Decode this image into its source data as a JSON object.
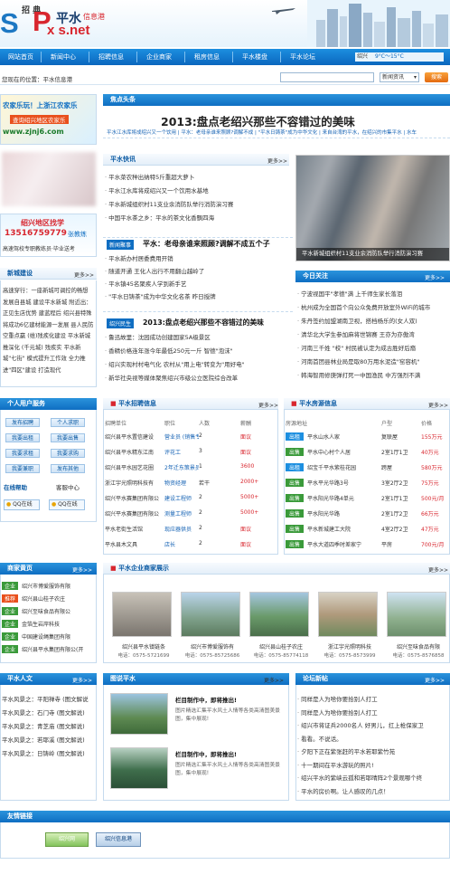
{
  "header": {
    "logo_left": "S",
    "logo_mid": "P",
    "logo_net": "x  s.net",
    "logo_top": "招 典",
    "logo_cn": "平水",
    "logo_tag": "信息港"
  },
  "nav": {
    "items": [
      "网站首页",
      "新闻中心",
      "招聘信息",
      "企业商家",
      "租房信息",
      "平水楼盘",
      "平水论坛"
    ],
    "weather_city": "绍兴",
    "weather_temp": "9°C～15°C"
  },
  "locbar": {
    "location": "您现在的位置：平水信息港",
    "search_placeholder": "",
    "select_value": "新闻资讯",
    "search_button": "搜索"
  },
  "left_ad1": {
    "line1": "农家乐玩！上浙江农家乐",
    "line2": "查询绍兴地区农家乐",
    "url": "www.zjnj6.com"
  },
  "left_ad2": {
    "title": "绍兴地区找学",
    "phone": "13516759779",
    "contact": "张教练",
    "slogan": "高速驾校专职教练员·毕业送考"
  },
  "headline": {
    "section": "焦点头条",
    "title": "2013:盘点老绍兴那些不容错过的美味",
    "subs": [
      "平水江水库将成绍兴又一个饮用",
      "平水：老母亲谁来照顾?调解不成",
      "\"平水日铸茶\"成为中华文化",
      "来自台湾的平水，在绍兴的市集平水",
      "水车"
    ]
  },
  "flash": {
    "section": "平水快讯",
    "more": "更多>>",
    "items": [
      "平水菜农种出纳特5斤重超大萝卜",
      "平水江水库将成绍兴又一个饮用水基地",
      "平水新城组织村11支业余消防队举行消防演习赛",
      "中国平水茶之乡：平水的茶文化香飘四海"
    ]
  },
  "photo_caption": "平水新城组织村11支业余消防队举行消防演习赛",
  "newsmass": {
    "tag": "新闻聚事",
    "title": "平水：老母亲谁来照顾?调解不成五个子",
    "items": [
      "平水新办村居委费用开销",
      "随道开通 王化人出行不用翻山越岭了",
      "平水镇45名聚疾人学到新手艺",
      "\"平水日铸茶\"成为中华文化名茶 昨日授牌"
    ]
  },
  "folk": {
    "tag": "绍兴民生",
    "title": "2013:盘点老绍兴那些不容错过的美味",
    "items": [
      "鲁迅故里：沈园成功创建国家5A级景区",
      "香精价格连年涨今年最低250元一斤 智德\"泡沫\"",
      "绍兴实现村村电气化 农村从\"用上电\"转变为\"用好电\"",
      "新华社央视等媒体聚焦绍兴市级公立医院综合改革"
    ]
  },
  "newcity": {
    "section": "新城建设",
    "more": "更多>>",
    "text": "高速穿行：一座新城可调控的畅想  发展自县城 建设平水新城  附近出：正见生店优势 建蓝程后  绍兴县特殊将成功6亿建材能源一发展  县人民防空重点赢 (维)残疾化建设  平水新城推深化 (千元城) 残疾实  平水新城\"七街\" 模式提升工作效  全力推进\"四区\"建设 打造现代"
  },
  "today": {
    "section": "今日关注",
    "more": "更多>>",
    "items": [
      "宁波视国平\"孝德\"满 上千师生家长落泪",
      "杭州成为全国首个向公众免费开放室外WiFi的城市",
      "朱丹签约加盟湖南卫视，搭档杨乐的(女人双)",
      "清华北大学生参加麻将世锦赛 王亦为亦傲湾",
      "河南三千姓 \"校\" 村民被认定为成古胜好后裔",
      "河南首团县林业局是取80万用水泥造\"窑容机\"",
      "韩海智用修庚弹打死一中国渔民 中方强烈不满"
    ]
  },
  "personal": {
    "section": "个人用户服务",
    "buttons": [
      "发布招聘",
      "个人求职",
      "我要出租",
      "我要出售",
      "我要求租",
      "我要求购",
      "我要兼职",
      "发布其他"
    ],
    "online_label": "在线帮助",
    "qq_label": "客服中心",
    "qq_btn": "QQ在线"
  },
  "jobs": {
    "section": "平水招聘信息",
    "more": "更多>>",
    "headers": [
      "招聘单位",
      "职位",
      "人数",
      "薪酬"
    ],
    "rows": [
      [
        "绍兴县平水置信建设",
        "营业员 (销售专",
        "2",
        "面议"
      ],
      [
        "绍兴县平水精东江南",
        "评花工",
        "3",
        "面议"
      ],
      [
        "绍兴县平水园艺花圈",
        "2年迁东策景员",
        "1",
        "3600"
      ],
      [
        "浙江宇光照明科技有",
        "物资经理",
        "若干",
        "2000+"
      ],
      [
        "绍兴平水赛集团有限公",
        "建设工程师",
        "2",
        "5000+"
      ],
      [
        "绍兴平水赛集团有限公",
        "测量工程师",
        "2",
        "5000+"
      ],
      [
        "平水老街生活馆",
        "现应器供员",
        "2",
        "面议"
      ],
      [
        "平水县木文具",
        "店长",
        "2",
        "面议"
      ]
    ]
  },
  "rent": {
    "section": "平水房源信息",
    "more": "更多>>",
    "headers": [
      "房源地址",
      "户型",
      "价格"
    ],
    "rows": [
      [
        "出租",
        "平水山水人家",
        "复联屋",
        "155万元"
      ],
      [
        "出售",
        "平水中心村个人居",
        "2室1厅1卫",
        "40万元"
      ],
      [
        "出租",
        "绍宝千平水紫桂花园",
        "跨屋",
        "580万元"
      ],
      [
        "出售",
        "平水平光华路3号",
        "3室2厅2卫",
        "75万元"
      ],
      [
        "出售",
        "平水阳光华路4单元",
        "2室1厅1卫",
        "500元/月"
      ],
      [
        "出售",
        "平水阳光华路",
        "2室1厅2卫",
        "66万元"
      ],
      [
        "出售",
        "平水新城建工大院",
        "4室2厅2卫",
        "47万元"
      ],
      [
        "出售",
        "平水大道四季时差家宁",
        "平房",
        "700元/月"
      ]
    ]
  },
  "yellow": {
    "section": "商家黄页",
    "more": "更多>>",
    "tags": [
      "企业",
      "推荐",
      "企业",
      "企业",
      "企业",
      "企业"
    ],
    "items": [
      "绍兴市博爱服饰有限",
      "绍兴县山桂子农庄",
      "绍兴至味食品有限公",
      "金箔生岩岸科技",
      "中国建设绳集团有限",
      "绍兴县平水集团有限公(开"
    ]
  },
  "business": {
    "section": "平水企业商家展示",
    "more": "更多>>",
    "items": [
      {
        "name": "绍兴县平水镇链条",
        "tel": "电话：0575-5721699"
      },
      {
        "name": "绍兴市博爱服饰有",
        "tel": "电话：0575-85725686"
      },
      {
        "name": "绍兴县山桂子农庄",
        "tel": "电话：0575-85774118"
      },
      {
        "name": "浙江宇光照明科技",
        "tel": "电话：0575-8573999"
      },
      {
        "name": "绍兴至味食品有限",
        "tel": "电话：0575-8576858"
      }
    ]
  },
  "humanities": {
    "section": "平水人文",
    "more": "更多>>",
    "items": [
      "平水风景之：平阳禅寺 (图文解说",
      "平水风景之：石门寺 (图文解说)",
      "平水风景之：青芝庙 (图文解说)",
      "平水风景之：若耶溪 (图文解说)",
      "平水风景之：日铸岭 (图文解说)"
    ]
  },
  "pics": {
    "section": "图说平水",
    "more": "更多>>",
    "items": [
      {
        "title": "栏目制作中，即将推出!",
        "desc": "图片精选汇集平水风土人情等各类高清图美景图，集中展现!"
      },
      {
        "title": "栏目制作中，即将推出!",
        "desc": "图片精选汇集平水风土人情等各类高清图美景图，集中展现!"
      }
    ]
  },
  "forum": {
    "section": "论坛新帖",
    "more": "更多>>",
    "items": [
      "同样是人为啥你要拾别人打工",
      "同样是人为啥你要拾别人打工",
      "绍兴市将证兵2000名人 好男儿，扛上枪保家卫",
      "看看。不说话。",
      "夕阳下正在紫张赶的平水若耶紫竹苑",
      "十一期间在平水游玩的照片!",
      "绍兴平水的紫峡云孤和若耶晴阵2个景观哪个终",
      "平水的房价啊。让人感叹的几点！"
    ]
  },
  "friendlinks": {
    "section": "友情链接",
    "logos": [
      "绍兴网",
      "绍兴信息港"
    ]
  }
}
